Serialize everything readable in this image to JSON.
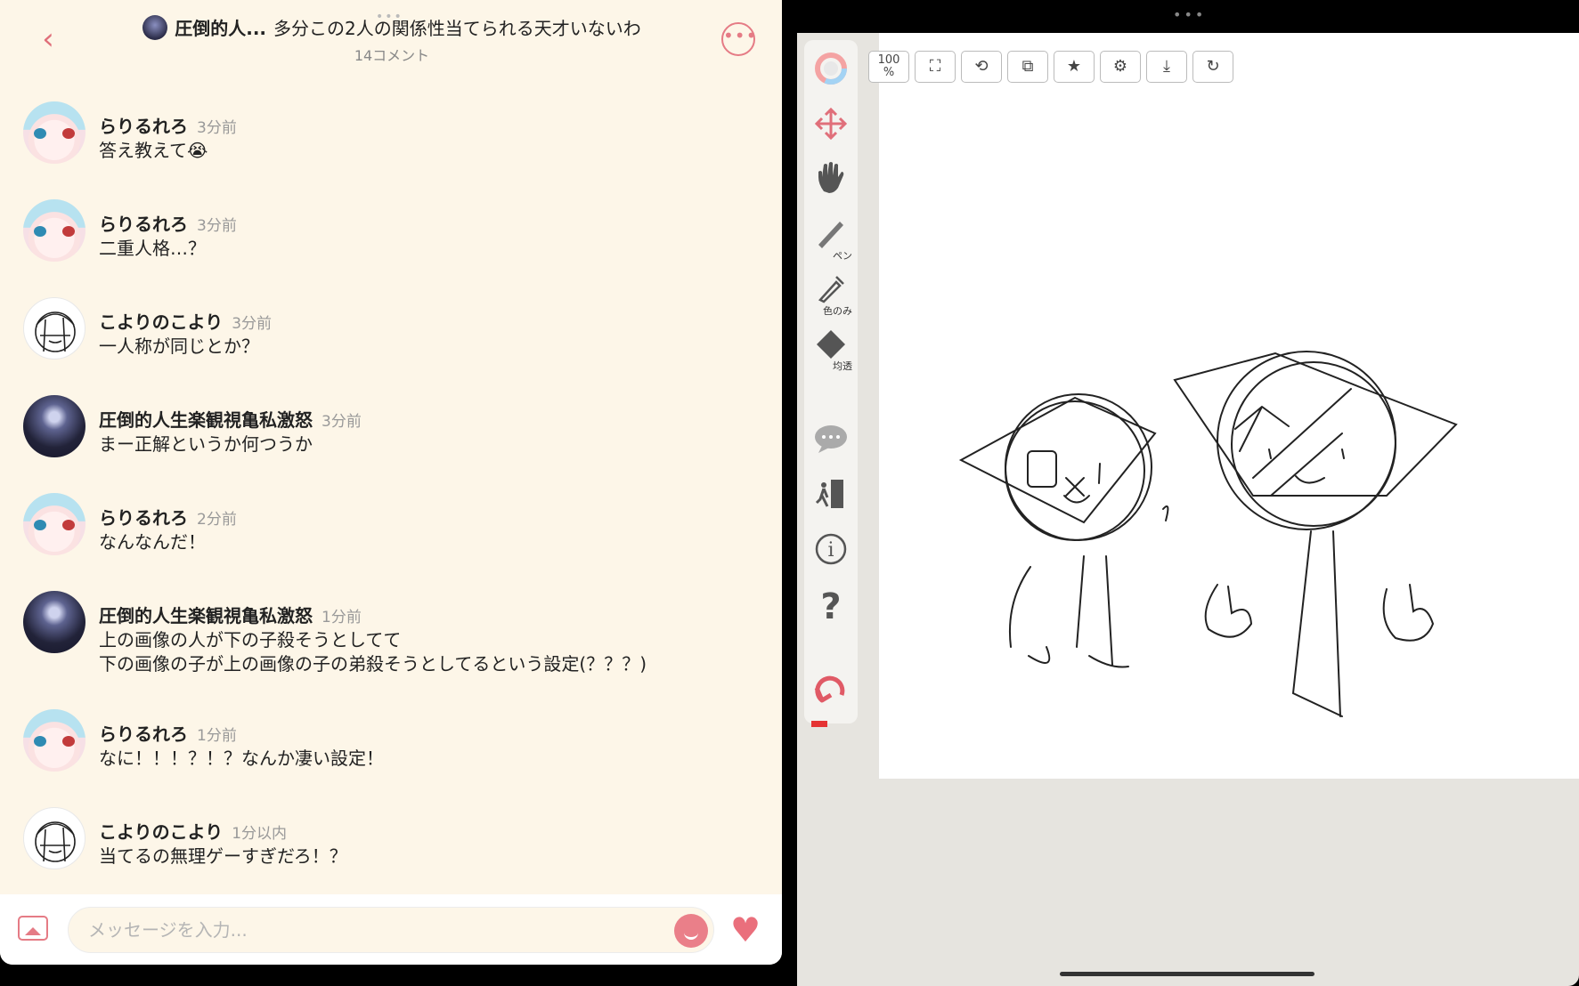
{
  "left_pane": {
    "header": {
      "user": "圧倒的人...",
      "title": "多分この2人の関係性当てられる天才いないわ",
      "comment_count": "14コメント",
      "back_icon": "chevron-left-icon",
      "more_icon": "more-horizontal-icon"
    },
    "comments": [
      {
        "avatar": "rirurero",
        "name": "らりるれろ",
        "time": "3分前",
        "text": "答え教えて😭"
      },
      {
        "avatar": "rirurero",
        "name": "らりるれろ",
        "time": "3分前",
        "text": "二重人格…？"
      },
      {
        "avatar": "koyori",
        "name": "こよりのこより",
        "time": "3分前",
        "text": "一人称が同じとか？"
      },
      {
        "avatar": "attou",
        "name": "圧倒的人生楽観視亀私激怒",
        "time": "3分前",
        "text": "まー正解というか何つうか"
      },
      {
        "avatar": "rirurero",
        "name": "らりるれろ",
        "time": "2分前",
        "text": "なんなんだ！"
      },
      {
        "avatar": "attou",
        "name": "圧倒的人生楽観視亀私激怒",
        "time": "1分前",
        "text": "上の画像の人が下の子殺そうとしてて\n下の画像の子が上の画像の子の弟殺そうとしてるという設定(？？？)"
      },
      {
        "avatar": "rirurero",
        "name": "らりるれろ",
        "time": "1分前",
        "text": "なに！！！？！？なんか凄い設定！"
      },
      {
        "avatar": "koyori",
        "name": "こよりのこより",
        "time": "1分以内",
        "text": "当てるの無理ゲーすぎだろ！？"
      }
    ],
    "input": {
      "placeholder": "メッセージを入力...",
      "image_icon": "image-icon",
      "emoji_icon": "smile-icon",
      "heart_icon": "heart-icon"
    }
  },
  "right_pane": {
    "top_tools": [
      {
        "name": "zoom",
        "label": "100\n%"
      },
      {
        "name": "fit-screen",
        "icon": "fit-screen-icon"
      },
      {
        "name": "rotate",
        "icon": "rotate-icon"
      },
      {
        "name": "flip",
        "icon": "flip-icon"
      },
      {
        "name": "favorite",
        "icon": "star-icon"
      },
      {
        "name": "settings",
        "icon": "gear-icon"
      },
      {
        "name": "download",
        "icon": "download-icon"
      },
      {
        "name": "redo",
        "icon": "redo-icon"
      }
    ],
    "side_tools": [
      {
        "name": "color",
        "icon": "color-wheel-icon",
        "label": ""
      },
      {
        "name": "move",
        "icon": "move-icon",
        "label": ""
      },
      {
        "name": "hand",
        "icon": "hand-icon",
        "label": ""
      },
      {
        "name": "pen",
        "icon": "pen-icon",
        "label": "ペン"
      },
      {
        "name": "eyedropper",
        "icon": "eyedropper-icon",
        "label": "色のみ"
      },
      {
        "name": "eraser",
        "icon": "eraser-icon",
        "label": "均透"
      },
      {
        "name": "chat",
        "icon": "chat-icon",
        "label": ""
      },
      {
        "name": "exit",
        "icon": "exit-icon",
        "label": ""
      },
      {
        "name": "info",
        "icon": "info-icon",
        "label": ""
      },
      {
        "name": "help",
        "icon": "help-icon",
        "label": "?"
      },
      {
        "name": "undo",
        "icon": "undo-icon",
        "label": ""
      }
    ]
  },
  "colors": {
    "accent": "#e57b85",
    "left_bg": "#fdf6e8",
    "right_bg": "#e6e4df",
    "undo_red": "#e53333"
  }
}
